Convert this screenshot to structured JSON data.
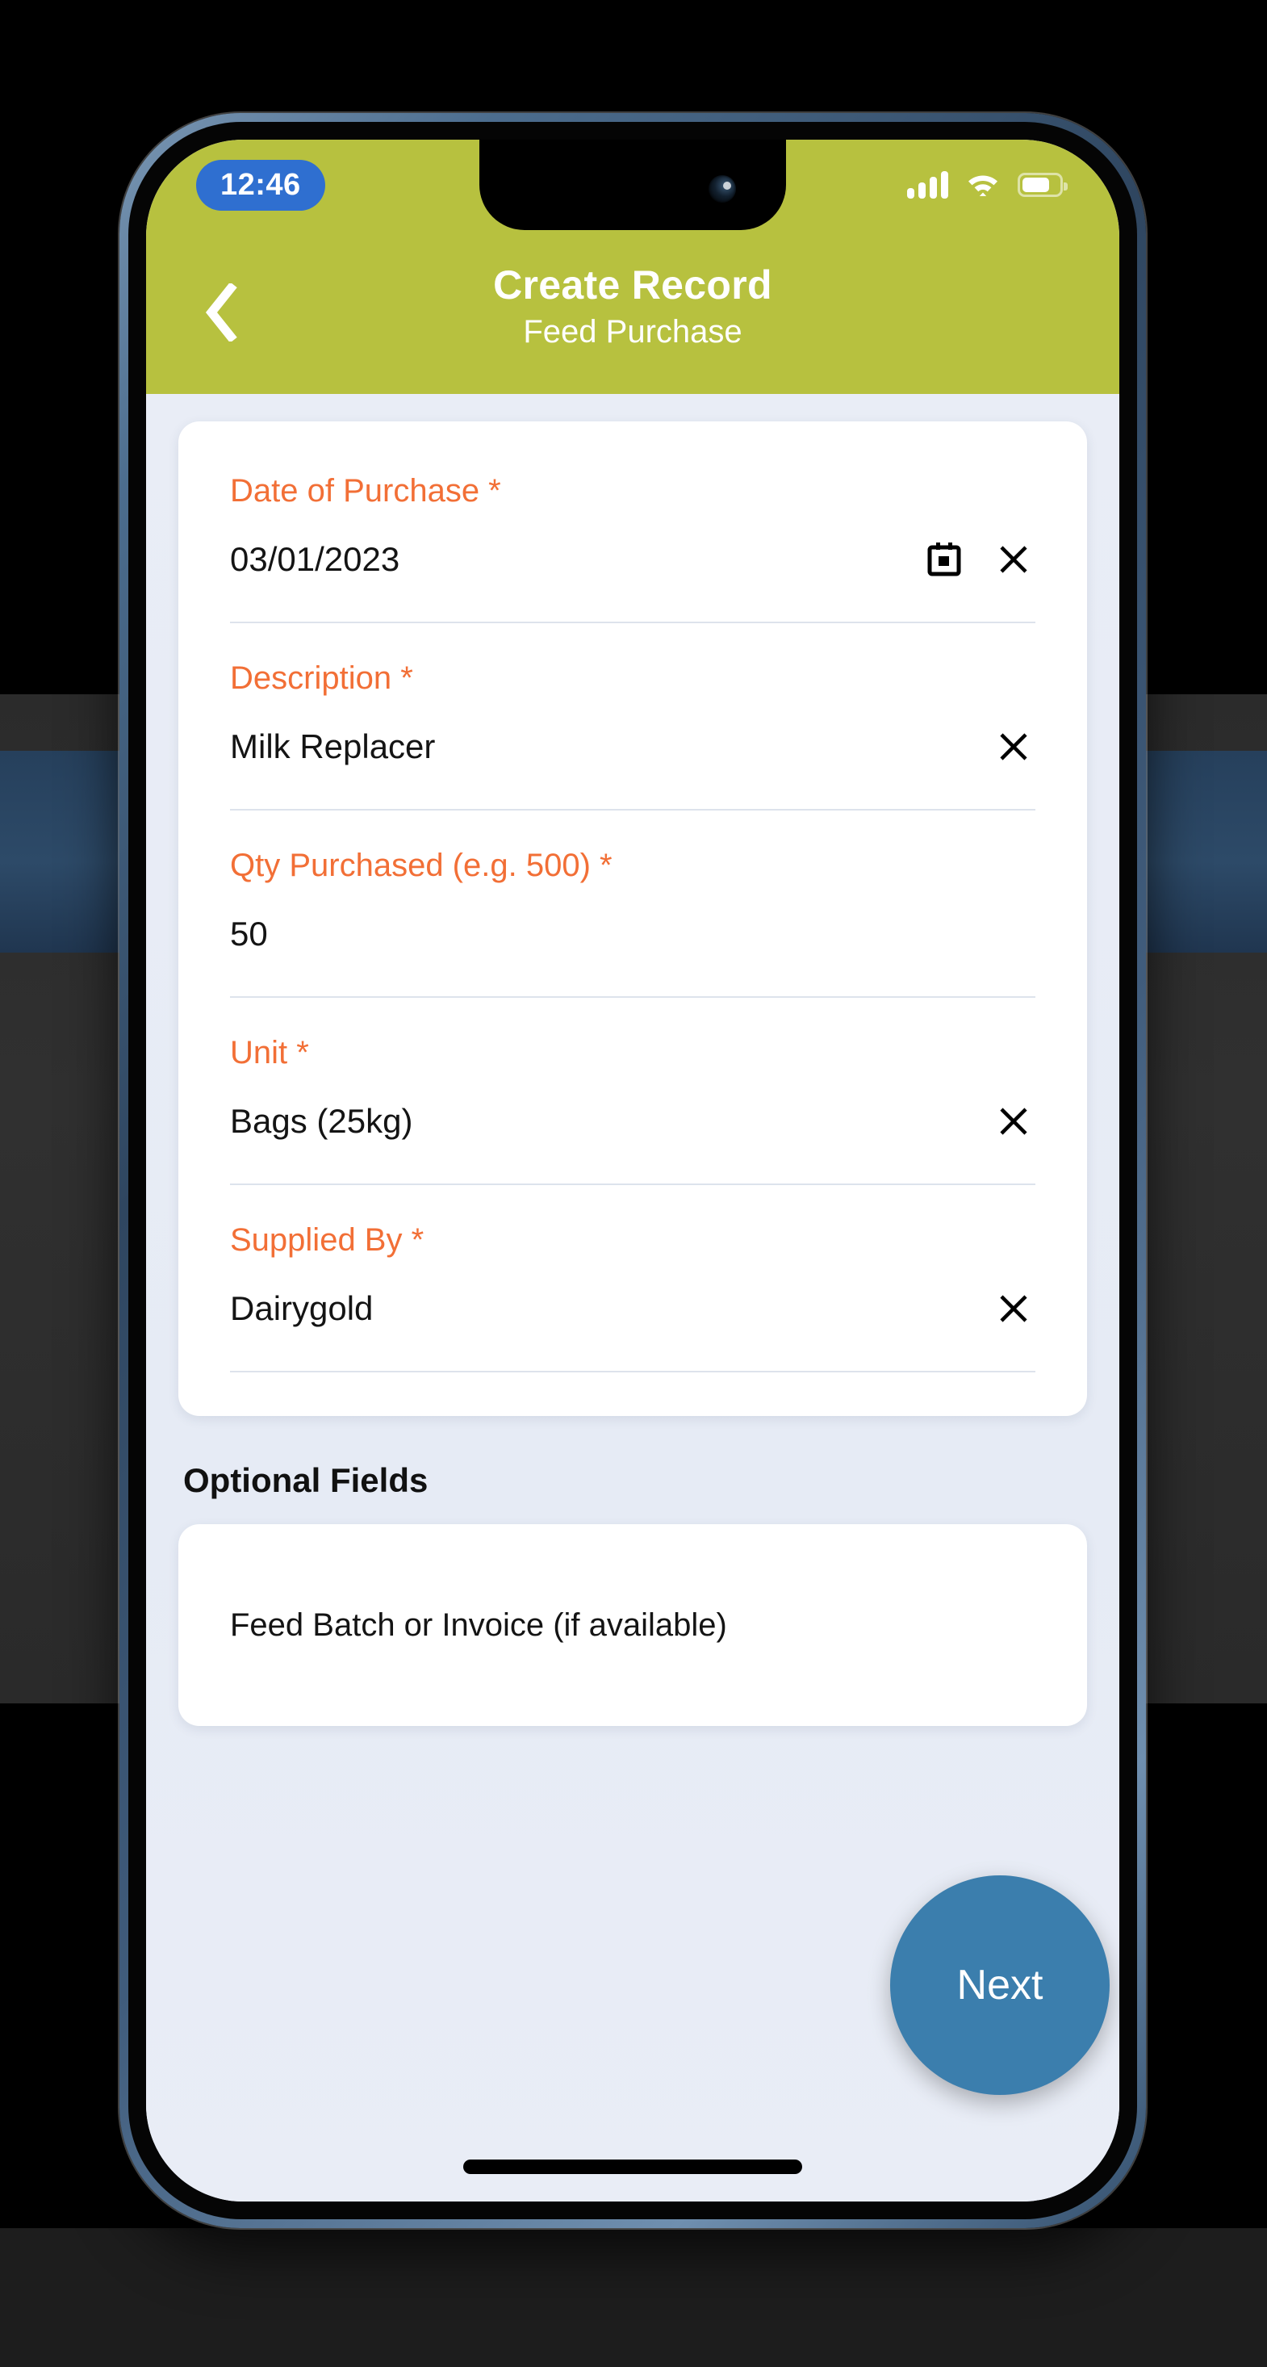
{
  "status_bar": {
    "time": "12:46",
    "signal_icon": "cellular-signal-icon",
    "wifi_icon": "wifi-icon",
    "battery_icon": "battery-icon",
    "battery_level_percent": 76
  },
  "header": {
    "back_icon": "back-chevron-icon",
    "title": "Create Record",
    "subtitle": "Feed Purchase",
    "background_color": "#b7c13f"
  },
  "form": {
    "required_marker": "*",
    "fields": [
      {
        "label": "Date of Purchase *",
        "value": "03/01/2023",
        "placeholder": "",
        "icons": [
          "calendar-icon",
          "clear-icon"
        ]
      },
      {
        "label": "Description *",
        "value": "Milk Replacer",
        "placeholder": "",
        "icons": [
          "clear-icon"
        ]
      },
      {
        "label": "Qty Purchased (e.g. 500) *",
        "value": "50",
        "placeholder": "",
        "icons": []
      },
      {
        "label": "Unit *",
        "value": "Bags (25kg)",
        "placeholder": "",
        "icons": [
          "clear-icon"
        ]
      },
      {
        "label": "Supplied By *",
        "value": "Dairygold",
        "placeholder": "",
        "icons": [
          "clear-icon"
        ]
      }
    ]
  },
  "optional_section": {
    "heading": "Optional Fields",
    "fields": [
      {
        "placeholder": "Feed Batch or Invoice (if available)",
        "value": ""
      }
    ]
  },
  "next_button": {
    "label": "Next",
    "color": "#3b7ead"
  },
  "colors": {
    "accent_green": "#b7c13f",
    "label_orange": "#f26f36",
    "page_background": "#e9edf6",
    "card_background": "#ffffff",
    "time_pill_blue": "#2f6fd0"
  }
}
